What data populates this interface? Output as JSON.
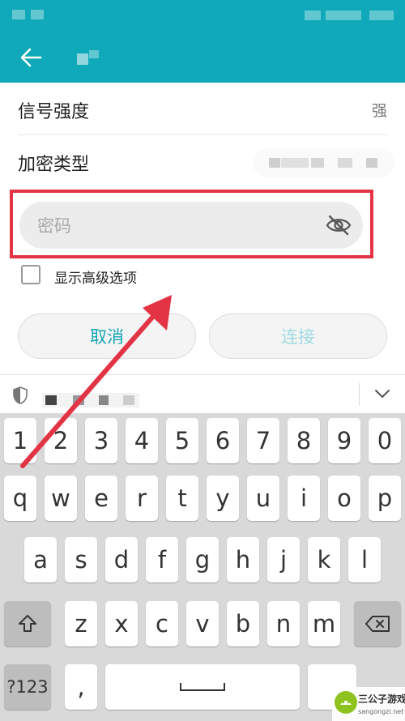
{
  "colors": {
    "header": "#10a9b9",
    "accent": "#12a6b5",
    "annotation": "#e23444"
  },
  "form": {
    "signal_label": "信号强度",
    "signal_value": "强",
    "encryption_label": "加密类型",
    "password_placeholder": "密码",
    "advanced_label": "显示高级选项",
    "advanced_checked": false,
    "cancel_label": "取消",
    "connect_label": "连接"
  },
  "keyboard": {
    "number_row": [
      "1",
      "2",
      "3",
      "4",
      "5",
      "6",
      "7",
      "8",
      "9",
      "0"
    ],
    "row1": [
      "q",
      "w",
      "e",
      "r",
      "t",
      "y",
      "u",
      "i",
      "o",
      "p"
    ],
    "row2": [
      "a",
      "s",
      "d",
      "f",
      "g",
      "h",
      "j",
      "k",
      "l"
    ],
    "row3": [
      "z",
      "x",
      "c",
      "v",
      "b",
      "n",
      "m"
    ],
    "sym_label": "?123",
    "comma_label": ","
  },
  "watermark": {
    "name": "三公子游戏网",
    "url": "sangongzi.net"
  },
  "icons": [
    "back-arrow-icon",
    "eye-off-icon",
    "shield-icon",
    "chevron-down-icon",
    "shift-icon",
    "backspace-icon",
    "space-icon"
  ]
}
